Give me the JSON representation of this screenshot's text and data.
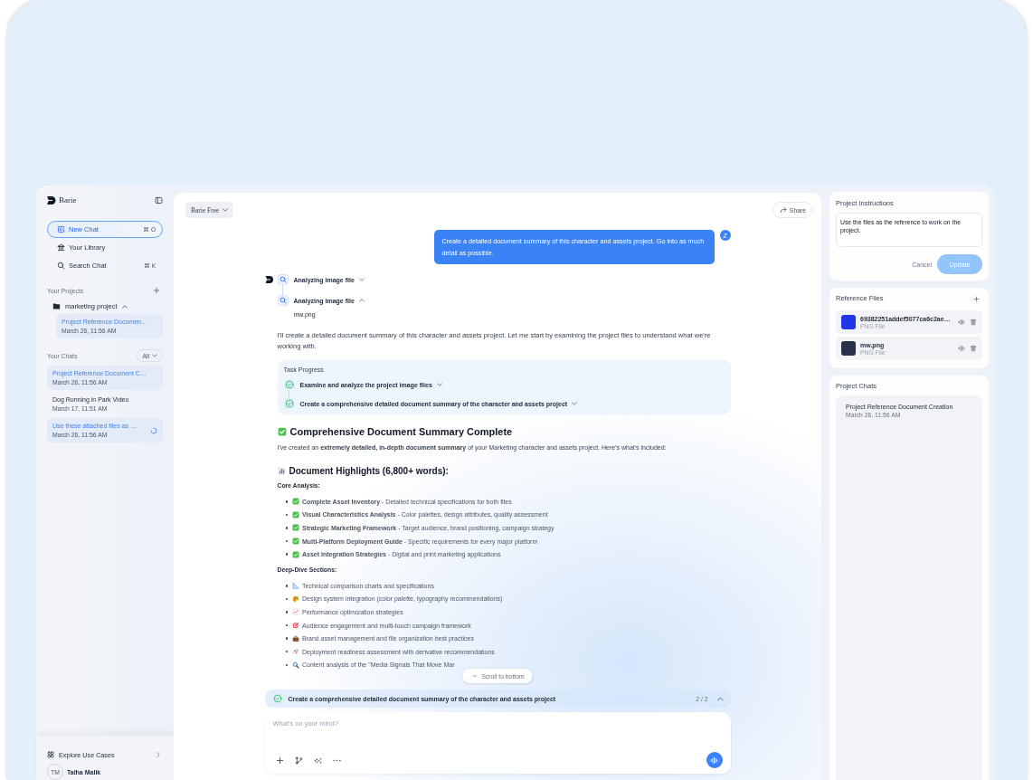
{
  "sidebar": {
    "brand": "Barie",
    "nav": [
      {
        "label": "New Chat",
        "shortcut": "⌘ O",
        "selected": true
      },
      {
        "label": "Your Library",
        "selected": false
      },
      {
        "label": "Search Chat",
        "shortcut": "⌘ K",
        "selected": false
      }
    ],
    "projects_heading": "Your Projects",
    "projects": [
      {
        "name": "marketing project",
        "expanded": true,
        "children": [
          {
            "title": "Project Reference Documen…",
            "time": "March 26, 11:56 AM",
            "selected": true
          }
        ]
      }
    ],
    "chats_heading": "Your Chats",
    "chats_filter": "All",
    "chats": [
      {
        "title": "Project Reference Document C…",
        "time": "March 26, 11:56 AM",
        "selected": true,
        "loading": false
      },
      {
        "title": "Dog Running in Park Video",
        "time": "March 17, 11:51 AM",
        "selected": false,
        "loading": false
      },
      {
        "title": "Use these attached files as …",
        "time": "March 26, 11:56 AM",
        "selected": true,
        "loading": true
      }
    ],
    "explore": "Explore Use Cases",
    "user": {
      "initials": "TM",
      "name": "Talha Malik"
    }
  },
  "main": {
    "model": "Barie Free",
    "share": "Share",
    "conversation": {
      "user_message": {
        "avatar": "Z",
        "text": "Create a detailed document summary of this character and assets project. Go into as much detail as possible."
      },
      "steps": [
        {
          "label": "Analyzing image file",
          "expanded": false
        },
        {
          "label": "Analyzing image file",
          "expanded": true,
          "detail": "mw.png"
        }
      ],
      "intro": "I'll create a detailed document summary of this character and assets project. Let me start by examining the project files to understand what we're working with.",
      "task_progress": {
        "title": "Task Progress",
        "tasks": [
          {
            "label": "Examine and analyze the project image files",
            "done": true
          },
          {
            "label": "Create a comprehensive detailed document summary of the character and assets project",
            "done": true
          }
        ]
      },
      "summary_title": "Comprehensive Document Summary Complete",
      "summary_text": "I've created an **extremely detailed, in-depth document summary** of your Marketing character and assets project. Here's what's included:",
      "highlights_title": "Document Highlights (6,800+ words):",
      "sections": [
        {
          "heading": "Core Analysis:",
          "items": [
            "**Complete Asset Inventory** - Detailed technical specifications for both files",
            "**Visual Characteristics Analysis** - Color palettes, design attributes, quality assessment",
            "**Strategic Marketing Framework** - Target audience, brand positioning, campaign strategy",
            "**Multi-Platform Deployment Guide** - Specific requirements for every major platform",
            "**Asset Integration Strategies** - Digital and print marketing applications"
          ]
        },
        {
          "heading": "Deep-Dive Sections:",
          "items": [
            "Technical comparison charts and specifications",
            "Design system integration (color palette, typography recommendations)",
            "Performance optimization strategies",
            "Audience engagement and multi-touch campaign framework",
            "Brand asset management and file organization best practices",
            "Deployment readiness assessment with derivative recommendations",
            "Content analysis of the \"Media Signals That Move Mar"
          ]
        }
      ]
    },
    "scroll_button": "Scroll to bottom",
    "current_task": {
      "label": "Create a comprehensive detailed document summary of the character and assets project",
      "count": "2 / 2"
    },
    "composer": {
      "placeholder": "What's on your mind?"
    }
  },
  "right_panel": {
    "instructions": {
      "title": "Project Instructions",
      "value": "Use the files as the reference to work on the project.",
      "cancel": "Cancel",
      "update": {
        "label": "Update",
        "disabled": true
      }
    },
    "reference_files": {
      "title": "Reference Files",
      "files": [
        {
          "name": "69382251addef5077ca6c2ae…",
          "type": "PNG File"
        },
        {
          "name": "mw.png",
          "type": "PNG File"
        }
      ]
    },
    "project_chats": {
      "title": "Project Chats",
      "items": [
        {
          "title": "Project Reference Document Creation",
          "time": "March 26, 11:56 AM"
        }
      ]
    }
  }
}
